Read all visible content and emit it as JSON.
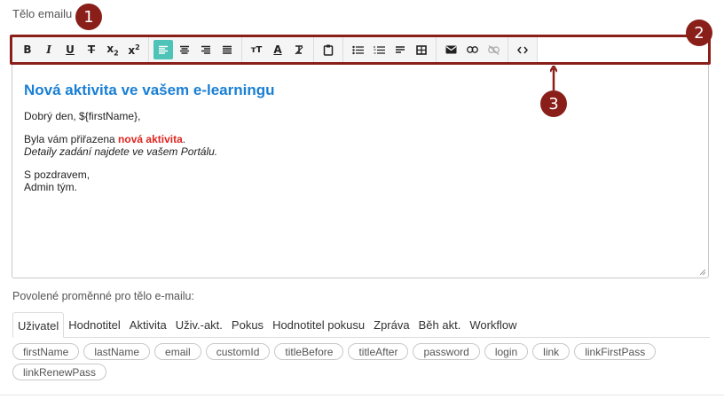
{
  "field_label": "Tělo emailu",
  "annotations": {
    "badge1": "1",
    "badge2": "2",
    "badge3": "3",
    "highlight_color": "#8a1f1a"
  },
  "toolbar": {
    "groups": [
      [
        {
          "name": "bold-icon",
          "glyph": "B"
        },
        {
          "name": "italic-icon",
          "glyph": "I"
        },
        {
          "name": "underline-icon",
          "glyph": "U"
        },
        {
          "name": "strikethrough-icon",
          "glyph": "S"
        },
        {
          "name": "subscript-icon",
          "glyph": "x₂"
        },
        {
          "name": "superscript-icon",
          "glyph": "x²"
        }
      ],
      [
        {
          "name": "align-left-icon",
          "active": true
        },
        {
          "name": "align-center-icon"
        },
        {
          "name": "align-right-icon"
        },
        {
          "name": "align-justify-icon"
        }
      ],
      [
        {
          "name": "font-size-icon",
          "glyph": "тT"
        },
        {
          "name": "font-color-icon",
          "glyph": "A"
        },
        {
          "name": "clear-format-icon",
          "glyph": "T"
        }
      ],
      [
        {
          "name": "paste-icon"
        }
      ],
      [
        {
          "name": "bullet-list-icon"
        },
        {
          "name": "numbered-list-icon"
        },
        {
          "name": "horizontal-rule-icon"
        },
        {
          "name": "table-icon"
        }
      ],
      [
        {
          "name": "email-icon"
        },
        {
          "name": "link-icon"
        },
        {
          "name": "unlink-icon"
        }
      ],
      [
        {
          "name": "source-code-icon",
          "glyph": "‹›"
        }
      ]
    ],
    "accent_color": "#4ec3b8"
  },
  "content": {
    "heading": "Nová aktivita ve vašem e-learningu",
    "greeting": "Dobrý den, ${firstName},",
    "line1_pre": "Byla vám přiřazena ",
    "line1_highlight": "nová aktivita",
    "line1_post": ".",
    "line2": "Detaily zadání najdete ve vašem Portálu.",
    "sign1": "S pozdravem,",
    "sign2": "Admin tým.",
    "heading_color": "#1a7fd4",
    "highlight_color": "#e0251f"
  },
  "variables": {
    "label": "Povolené proměnné pro tělo e-mailu:",
    "tabs": [
      "Uživatel",
      "Hodnotitel",
      "Aktivita",
      "Uživ.-akt.",
      "Pokus",
      "Hodnotitel pokusu",
      "Zpráva",
      "Běh akt.",
      "Workflow"
    ],
    "active_tab": "Uživatel",
    "chips": [
      "firstName",
      "lastName",
      "email",
      "customId",
      "titleBefore",
      "titleAfter",
      "password",
      "login",
      "link",
      "linkFirstPass",
      "linkRenewPass"
    ]
  }
}
